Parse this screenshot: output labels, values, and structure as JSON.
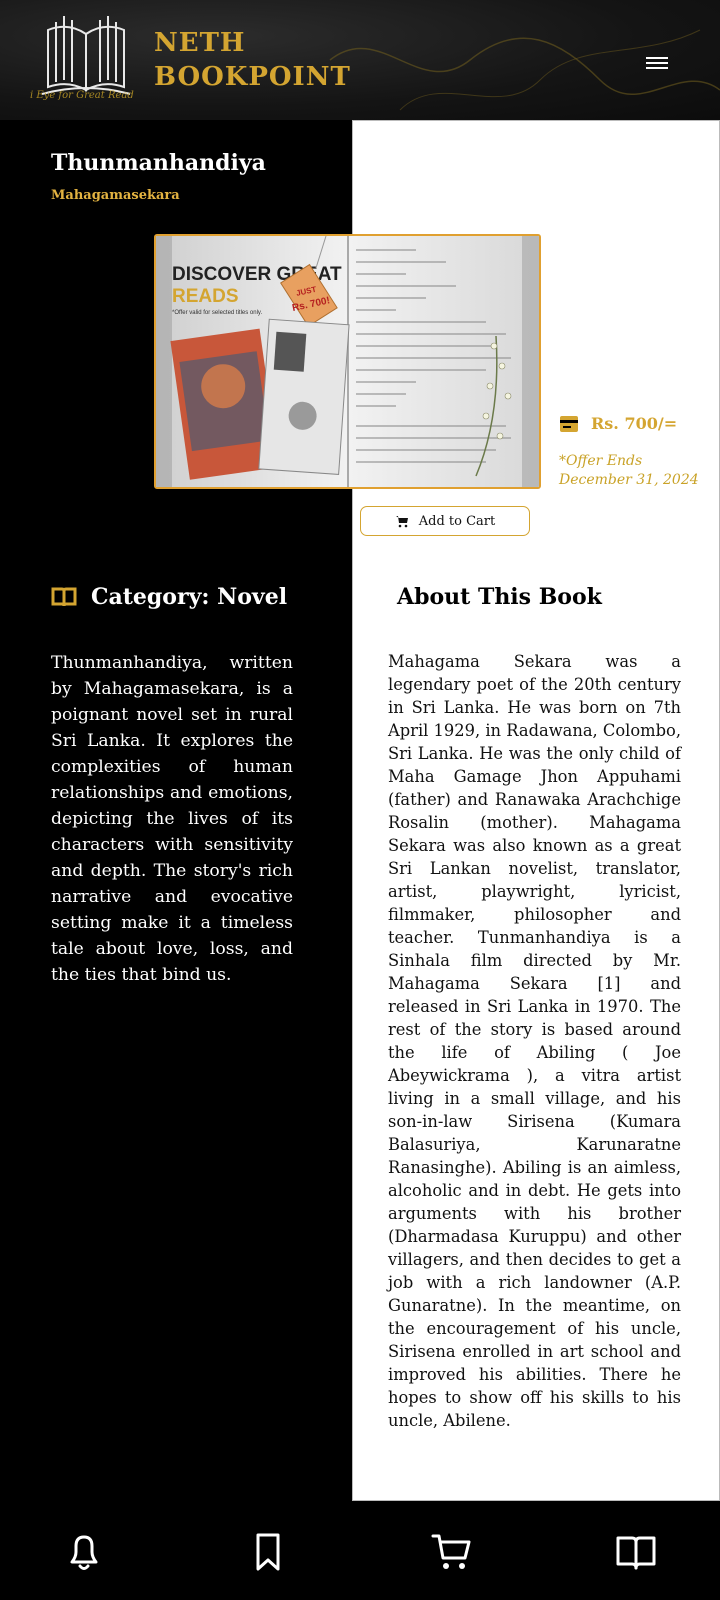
{
  "header": {
    "brand_line1": "NETH",
    "brand_line2": "BOOKPOINT",
    "tagline": "i Eye for Great Read",
    "menu_icon": "hamburger-menu-icon"
  },
  "book": {
    "title": "Thunmanhandiya",
    "author": "Mahagamasekara",
    "image_text": {
      "banner_line1": "DISCOVER GREAT",
      "banner_line2": "READS",
      "banner_note": "*Offer valid for selected titles only.",
      "tag_line1": "JUST",
      "tag_line2": "Rs. 700!"
    },
    "price": "Rs. 700/=",
    "offer": "*Offer Ends December 31, 2024",
    "add_to_cart": "Add to Cart",
    "category": "Category: Novel",
    "description": "Thunmanhandiya, written by Mahagamasekara, is a poignant novel set in rural Sri Lanka. It explores the complexities of human relationships and emotions, depicting the lives of its characters with sensitivity and depth. The story's rich narrative and evocative setting make it a timeless tale about love, loss, and the ties that bind us.",
    "about_heading": "About This Book",
    "about_text": "Mahagama Sekara was a legendary poet of the 20th century in Sri Lanka. He was born on 7th April 1929, in Radawana, Colombo, Sri Lanka. He was the only child of Maha Gamage Jhon Appuhami (father) and Ranawaka Arachchige Rosalin (mother). Mahagama Sekara was also known as a great Sri Lankan novelist, translator, artist, playwright, lyricist, filmmaker, philosopher and teacher. Tunmanhandiya is a Sinhala film directed by Mr. Mahagama Sekara [1] and released in Sri Lanka in 1970. The rest of the story is based around the life of Abiling ( Joe Abeywickrama ), a vitra artist living in a small village, and his son-in-law Sirisena (Kumara Balasuriya, Karunaratne Ranasinghe). Abiling is an aimless, alcoholic and in debt. He gets into arguments with his brother (Dharmadasa Kuruppu) and other villagers, and then decides to get a job with a rich landowner (A.P. Gunaratne). In the meantime, on the encouragement of his uncle, Sirisena enrolled in art school and improved his abilities. There he hopes to show off his skills to his uncle, Abilene."
  },
  "bottom_nav": [
    "bell-icon",
    "bookmark-icon",
    "cart-icon",
    "open-book-icon"
  ],
  "colors": {
    "accent": "#d4a531",
    "background": "#000000",
    "panel": "#ffffff"
  }
}
